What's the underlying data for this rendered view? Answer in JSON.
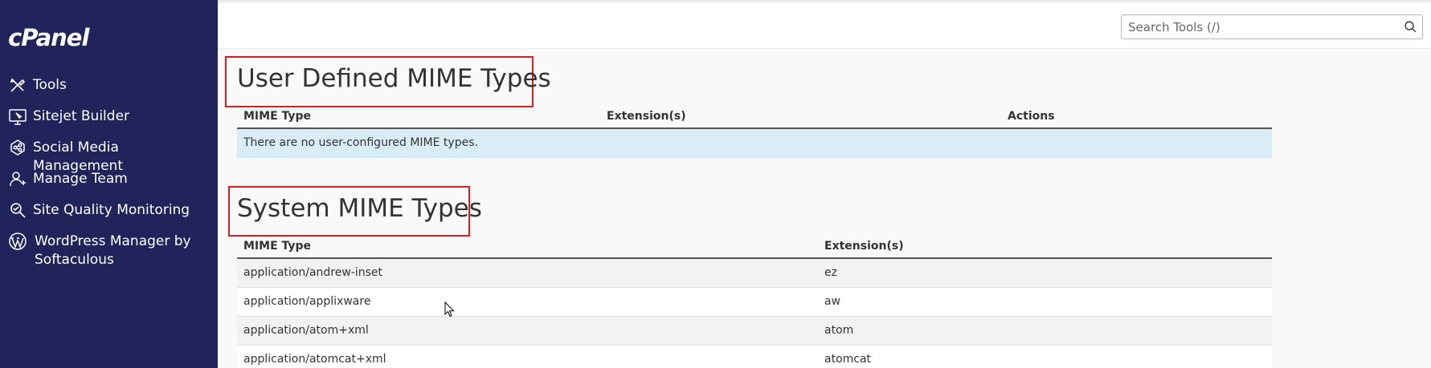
{
  "sidebar": {
    "logo": "cPanel",
    "items": [
      {
        "label": "Tools",
        "icon": "tools-icon"
      },
      {
        "label": "Sitejet Builder",
        "icon": "sitejet-builder-icon"
      },
      {
        "label": "Social Media Management",
        "icon": "social-media-icon"
      },
      {
        "label": "Manage Team",
        "icon": "manage-team-icon"
      },
      {
        "label": "Site Quality Monitoring",
        "icon": "site-quality-icon"
      },
      {
        "label": "WordPress Manager by",
        "label2": "Softaculous",
        "icon": "wordpress-icon"
      }
    ]
  },
  "search": {
    "placeholder": "Search Tools (/)",
    "icon": "search-icon"
  },
  "user_defined": {
    "title": "User Defined MIME Types",
    "columns": [
      "MIME Type",
      "Extension(s)",
      "Actions"
    ],
    "empty_message": "There are no user-configured MIME types."
  },
  "system": {
    "title": "System MIME Types",
    "columns": [
      "MIME Type",
      "Extension(s)"
    ],
    "rows": [
      {
        "type": "application/andrew-inset",
        "ext": "ez"
      },
      {
        "type": "application/applixware",
        "ext": "aw"
      },
      {
        "type": "application/atom+xml",
        "ext": "atom"
      },
      {
        "type": "application/atomcat+xml",
        "ext": "atomcat"
      }
    ]
  },
  "colors": {
    "sidebar_bg": "#20245a",
    "highlight": "#d42020",
    "info_row": "#d9edf7"
  }
}
